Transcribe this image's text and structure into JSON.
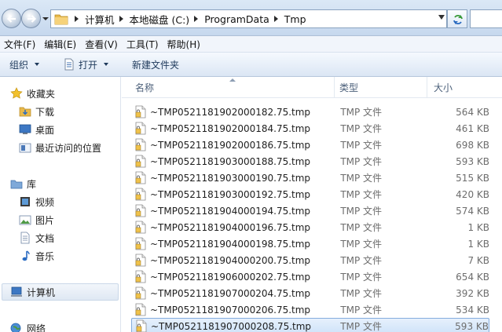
{
  "address": {
    "breadcrumbs": [
      "计算机",
      "本地磁盘 (C:)",
      "ProgramData",
      "Tmp"
    ]
  },
  "menu": [
    "文件(F)",
    "编辑(E)",
    "查看(V)",
    "工具(T)",
    "帮助(H)"
  ],
  "toolbar": {
    "organize": "组织",
    "open": "打开",
    "new_folder": "新建文件夹"
  },
  "nav": {
    "favorites": "收藏夹",
    "downloads": "下载",
    "desktop": "桌面",
    "recent": "最近访问的位置",
    "libraries": "库",
    "videos": "视频",
    "pictures": "图片",
    "documents": "文档",
    "music": "音乐",
    "computer": "计算机",
    "network": "网络"
  },
  "columns": {
    "name": "名称",
    "type": "类型",
    "size": "大小"
  },
  "files": [
    {
      "name": "~TMP0521181902000182.75.tmp",
      "type": "TMP 文件",
      "size": "564 KB"
    },
    {
      "name": "~TMP0521181902000184.75.tmp",
      "type": "TMP 文件",
      "size": "461 KB"
    },
    {
      "name": "~TMP0521181902000186.75.tmp",
      "type": "TMP 文件",
      "size": "698 KB"
    },
    {
      "name": "~TMP0521181903000188.75.tmp",
      "type": "TMP 文件",
      "size": "593 KB"
    },
    {
      "name": "~TMP0521181903000190.75.tmp",
      "type": "TMP 文件",
      "size": "515 KB"
    },
    {
      "name": "~TMP0521181903000192.75.tmp",
      "type": "TMP 文件",
      "size": "420 KB"
    },
    {
      "name": "~TMP0521181904000194.75.tmp",
      "type": "TMP 文件",
      "size": "574 KB"
    },
    {
      "name": "~TMP0521181904000196.75.tmp",
      "type": "TMP 文件",
      "size": "1 KB"
    },
    {
      "name": "~TMP0521181904000198.75.tmp",
      "type": "TMP 文件",
      "size": "1 KB"
    },
    {
      "name": "~TMP0521181904000200.75.tmp",
      "type": "TMP 文件",
      "size": "7 KB"
    },
    {
      "name": "~TMP0521181906000202.75.tmp",
      "type": "TMP 文件",
      "size": "654 KB"
    },
    {
      "name": "~TMP0521181907000204.75.tmp",
      "type": "TMP 文件",
      "size": "392 KB"
    },
    {
      "name": "~TMP0521181907000206.75.tmp",
      "type": "TMP 文件",
      "size": "534 KB"
    },
    {
      "name": "~TMP0521181907000208.75.tmp",
      "type": "TMP 文件",
      "size": "593 KB",
      "selected": true
    }
  ],
  "icons": {
    "back": "back-arrow-icon",
    "forward": "forward-arrow-icon",
    "refresh": "refresh-icon",
    "file": "tmp-file-icon"
  }
}
